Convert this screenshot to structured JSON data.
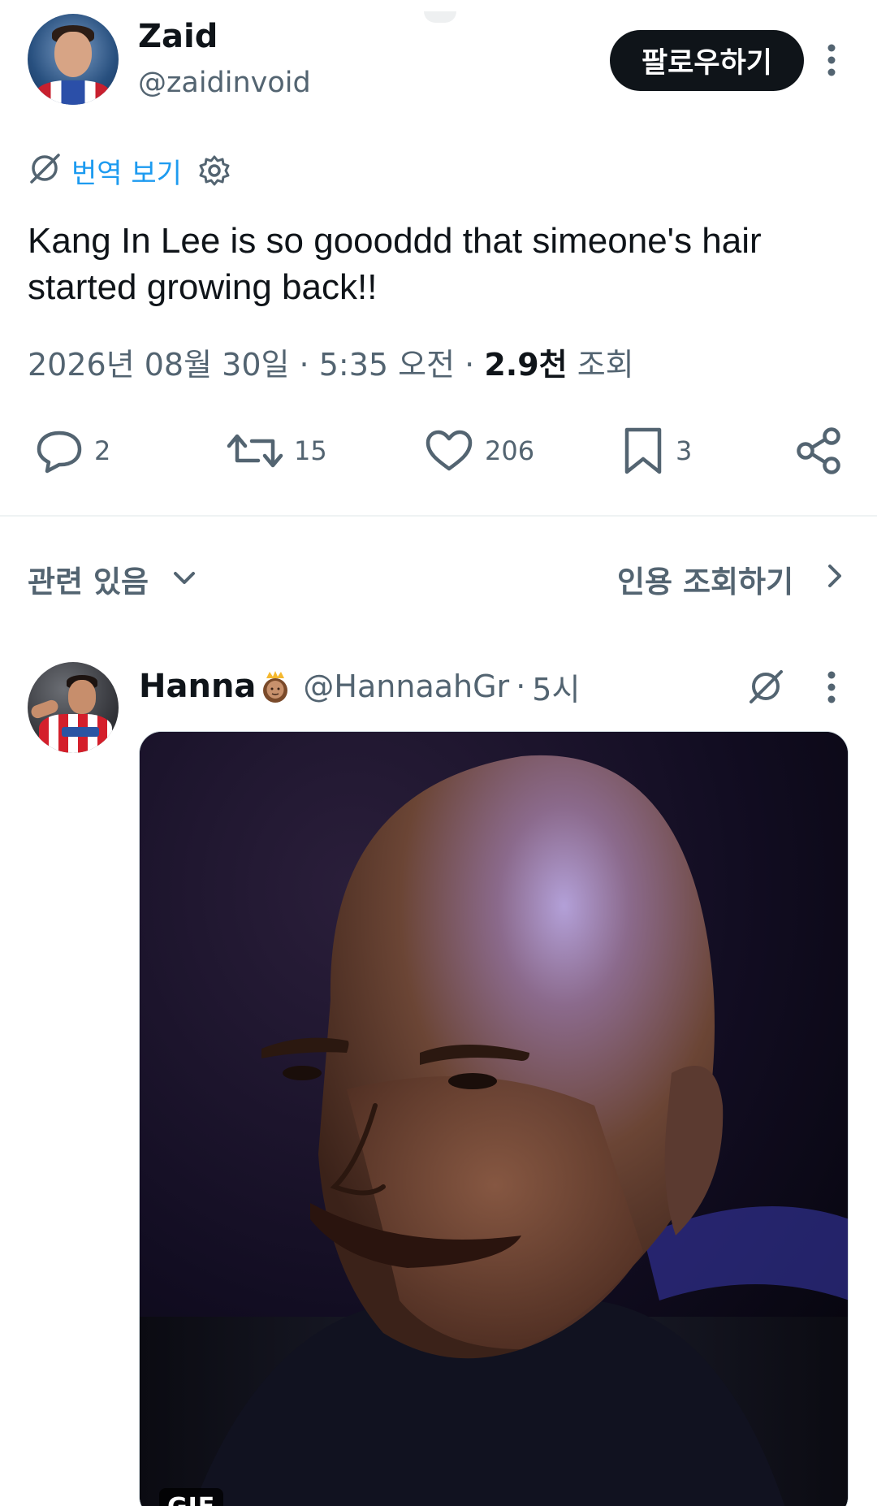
{
  "main_tweet": {
    "author_name": "Zaid",
    "author_handle": "@zaidinvoid",
    "follow_label": "팔로우하기",
    "translate_label": "번역 보기",
    "text": "Kang In Lee is so goooddd that simeone's hair started growing back!!",
    "date": "2026년 08월 30일",
    "time": "5:35 오전",
    "views_count": "2.9천",
    "views_label": "조회",
    "actions": {
      "replies": "2",
      "retweets": "15",
      "likes": "206",
      "bookmarks": "3"
    }
  },
  "related": {
    "label": "관련 있음",
    "quotes_label": "인용 조회하기"
  },
  "reply_tweet": {
    "author_name": "Hanna",
    "author_handle": "@HannaahGr",
    "time": "5시",
    "media_badge": "GIF"
  },
  "colors": {
    "text_primary": "#0f1419",
    "text_secondary": "#536471",
    "accent_blue": "#1d9bf0",
    "follow_bg": "#0f1419",
    "divider": "#eff3f4"
  },
  "icons": {
    "more": "more-vertical-icon",
    "translate": "globe-slash-icon",
    "settings": "gear-icon",
    "reply": "speech-bubble-icon",
    "retweet": "retweet-arrows-icon",
    "like": "heart-icon",
    "bookmark": "bookmark-icon",
    "share": "share-nodes-icon",
    "chevron_down": "chevron-down-icon",
    "chevron_right": "chevron-right-icon",
    "emoji": "princess-emoji-icon"
  }
}
